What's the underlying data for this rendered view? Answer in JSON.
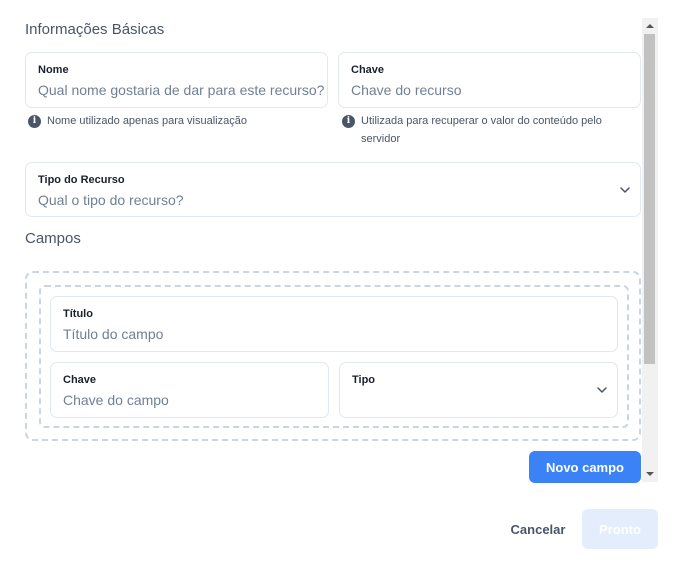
{
  "basic": {
    "title": "Informações Básicas",
    "name": {
      "label": "Nome",
      "placeholder": "Qual nome gostaria de dar para este recurso?",
      "hint": "Nome utilizado apenas para visualização"
    },
    "key": {
      "label": "Chave",
      "placeholder": "Chave do recurso",
      "hint": "Utilizada para recuperar o valor do conteúdo pelo servidor"
    },
    "type": {
      "label": "Tipo do Recurso",
      "placeholder": "Qual o tipo do recurso?"
    }
  },
  "fields": {
    "title": "Campos",
    "title_field": {
      "label": "Título",
      "placeholder": "Título do campo"
    },
    "key_field": {
      "label": "Chave",
      "placeholder": "Chave do campo"
    },
    "type_field": {
      "label": "Tipo",
      "placeholder": ""
    },
    "add_button": "Novo campo"
  },
  "footer": {
    "cancel": "Cancelar",
    "done": "Pronto"
  },
  "icons": {
    "info": "info-icon",
    "chevron": "chevron-down-icon"
  },
  "colors": {
    "accent": "#3b82f6",
    "done_disabled": "#e3edfc"
  }
}
